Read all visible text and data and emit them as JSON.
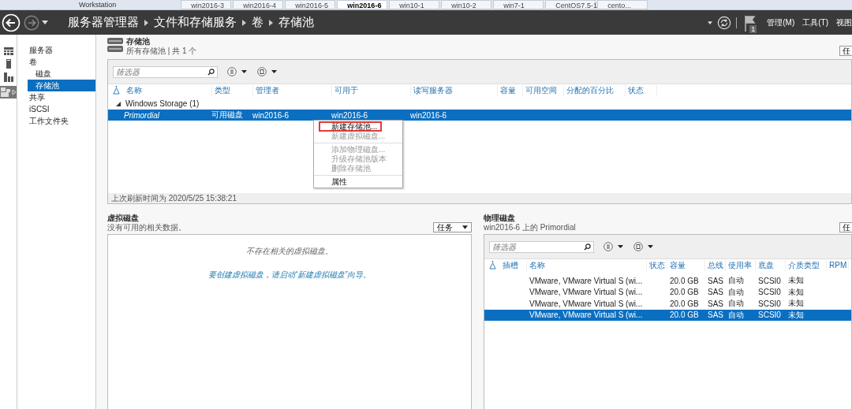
{
  "vm_tabs": {
    "app": "Workstation",
    "tabs": [
      {
        "label": "win2016-3",
        "selected": false
      },
      {
        "label": "win2016-4",
        "selected": false
      },
      {
        "label": "win2016-5",
        "selected": false
      },
      {
        "label": "win2016-6",
        "selected": true
      },
      {
        "label": "win10-1",
        "selected": false
      },
      {
        "label": "win10-2",
        "selected": false
      },
      {
        "label": "win7-1",
        "selected": false
      },
      {
        "label": "CentOS7.5-1",
        "selected": false
      },
      {
        "label": "cento...",
        "selected": false
      }
    ]
  },
  "header": {
    "breadcrumb": [
      "服务器管理器",
      "文件和存储服务",
      "卷",
      "存储池"
    ],
    "notification_count": "1",
    "menus": [
      "管理(M)",
      "工具(T)",
      "视图"
    ]
  },
  "sidebar": {
    "items": [
      {
        "label": "服务器",
        "selected": false
      },
      {
        "label": "卷",
        "selected": false,
        "children": [
          {
            "label": "磁盘",
            "selected": false
          },
          {
            "label": "存储池",
            "selected": true
          }
        ]
      },
      {
        "label": "共享",
        "selected": false
      },
      {
        "label": "iSCSI",
        "selected": false
      },
      {
        "label": "工作文件夹",
        "selected": false
      }
    ]
  },
  "storage_pools": {
    "title": "存储池",
    "subtitle": "所有存储池 | 共 1 个",
    "tasks_button": "任",
    "filter_placeholder": "筛选器",
    "columns": [
      "名称",
      "类型",
      "管理者",
      "可用于",
      "读写服务器",
      "容量",
      "可用空间",
      "分配的百分比",
      "状态"
    ],
    "group": "Windows Storage (1)",
    "rows": [
      {
        "cells": [
          "Primordial",
          "可用磁盘",
          "win2016-6",
          "win2016-6",
          "win2016-6"
        ],
        "selected": true
      }
    ],
    "refresh_time": "上次刷新时间为 2020/5/25 15:38:21",
    "context_menu": [
      {
        "label": "新建存储池...",
        "disabled": false,
        "highlighted": true,
        "separator_after": false
      },
      {
        "label": "新建虚拟磁盘...",
        "disabled": true,
        "highlighted": false,
        "separator_after": true
      },
      {
        "label": "添加物理磁盘...",
        "disabled": true,
        "highlighted": false,
        "separator_after": false
      },
      {
        "label": "升级存储池版本",
        "disabled": true,
        "highlighted": false,
        "separator_after": false
      },
      {
        "label": "删除存储池",
        "disabled": true,
        "highlighted": false,
        "separator_after": true
      },
      {
        "label": "属性",
        "disabled": false,
        "highlighted": false,
        "separator_after": false
      }
    ]
  },
  "virtual_disks": {
    "title": "虚拟磁盘",
    "subtitle": "没有可用的相关数据。",
    "tasks_button": "任务",
    "empty_message": "不存在相关的虚拟磁盘。",
    "hint_link": "要创建虚拟磁盘，请启动“新建虚拟磁盘”向导。"
  },
  "physical_disks": {
    "title": "物理磁盘",
    "subtitle": "win2016-6 上的 Primordial",
    "tasks_button": "任",
    "filter_placeholder": "筛选器",
    "columns": [
      "插槽",
      "名称",
      "状态",
      "容量",
      "总线",
      "使用率",
      "底盘",
      "介质类型",
      "RPM"
    ],
    "rows": [
      {
        "cells": [
          "",
          "VMware, VMware Virtual S (wi...",
          "",
          "20.0 GB",
          "SAS",
          "自动",
          "SCSI0",
          "未知",
          ""
        ],
        "selected": false
      },
      {
        "cells": [
          "",
          "VMware, VMware Virtual S (wi...",
          "",
          "20.0 GB",
          "SAS",
          "自动",
          "SCSI0",
          "未知",
          ""
        ],
        "selected": false
      },
      {
        "cells": [
          "",
          "VMware, VMware Virtual S (wi...",
          "",
          "20.0 GB",
          "SAS",
          "自动",
          "SCSI0",
          "未知",
          ""
        ],
        "selected": false
      },
      {
        "cells": [
          "",
          "VMware, VMware Virtual S (wi...",
          "",
          "20.0 GB",
          "SAS",
          "自动",
          "SCSI0",
          "未知",
          ""
        ],
        "selected": true
      }
    ]
  }
}
